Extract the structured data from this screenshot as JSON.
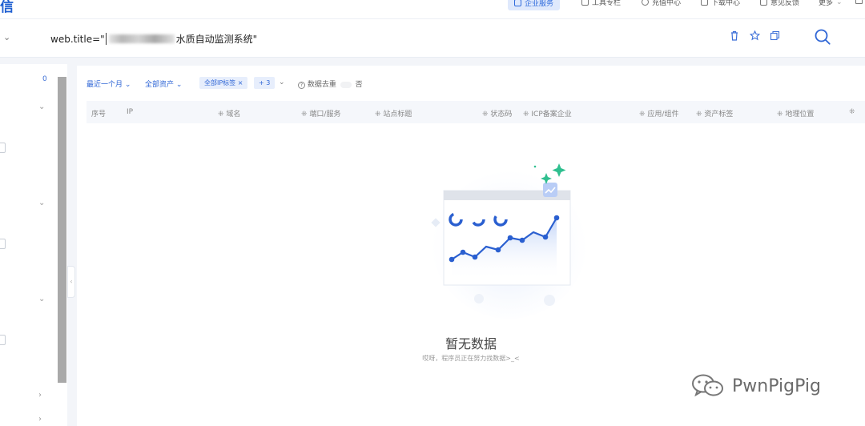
{
  "topnav": {
    "brand": "信",
    "items": [
      {
        "label": "企业服务"
      },
      {
        "label": "工具专栏"
      },
      {
        "label": "充值中心"
      },
      {
        "label": "下载中心"
      },
      {
        "label": "意见反馈"
      },
      {
        "label": "更多"
      }
    ]
  },
  "search": {
    "query_prefix": "web.title=\"",
    "query_suffix": "水质自动监测系统\""
  },
  "sidebar": {
    "count": "0"
  },
  "filters": {
    "time_range": "最近一个月",
    "asset_scope": "全部资产",
    "ip_tag_chip": "全部IP标签",
    "more_chip": "+ 3",
    "dedupe_label": "数据去重",
    "dedupe_value": "否"
  },
  "table": {
    "columns": [
      "序号",
      "IP",
      "域名",
      "端口/服务",
      "站点标题",
      "状态码",
      "ICP备案企业",
      "应用/组件",
      "资产标签",
      "地理位置"
    ]
  },
  "empty_state": {
    "title": "暂无数据",
    "subtitle": "哎呀，程序员正在努力找数据>_<"
  },
  "watermark": {
    "text": "PwnPigPig"
  },
  "colors": {
    "accent": "#2f66d6",
    "chart_line": "#2a5fd0",
    "sparkle": "#2fbf8f"
  }
}
